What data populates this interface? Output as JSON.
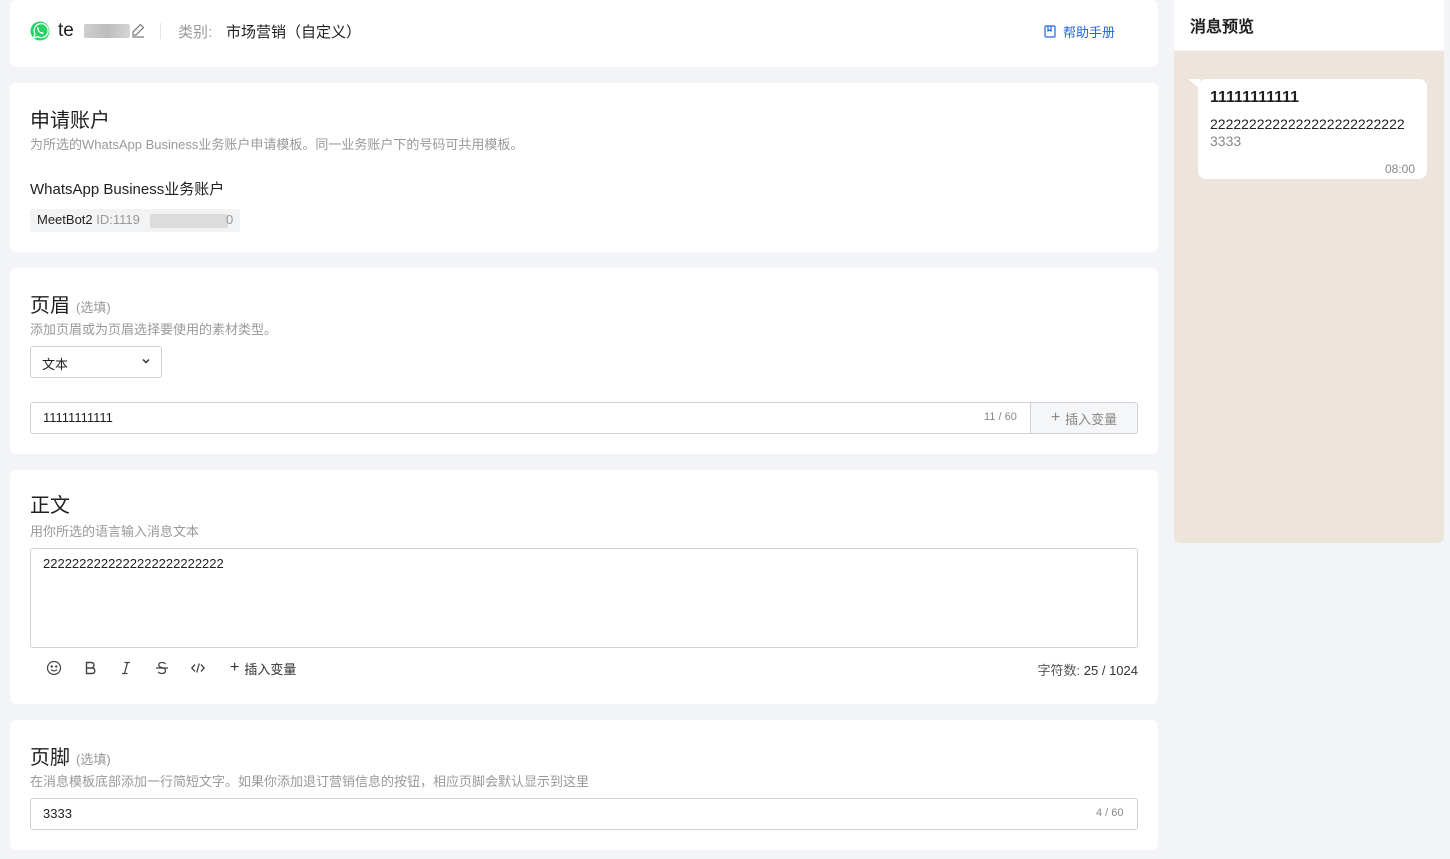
{
  "header": {
    "template_name": "te",
    "category_label": "类别:",
    "category_value": "市场营销（自定义）",
    "help_link": "帮助手册"
  },
  "account": {
    "title": "申请账户",
    "description": "为所选的WhatsApp Business业务账户申请模板。同一业务账户下的号码可共用模板。",
    "field_label": "WhatsApp Business业务账户",
    "account_name": "MeetBot2",
    "account_id_prefix": "ID:1119",
    "account_id_suffix": "0"
  },
  "page_header": {
    "title": "页眉",
    "optional": "(选填)",
    "description": "添加页眉或为页眉选择要使用的素材类型。",
    "type_selected": "文本",
    "text_value": "11111111111",
    "counter": "11 / 60",
    "insert_variable": "插入变量"
  },
  "body": {
    "title": "正文",
    "description": "用你所选的语言输入消息文本",
    "text_value": "2222222222222222222222222",
    "insert_variable": "插入变量",
    "char_count_label": "字符数:",
    "char_count_value": "25 / 1024"
  },
  "footer": {
    "title": "页脚",
    "optional": "(选填)",
    "description": "在消息模板底部添加一行简短文字。如果你添加退订营销信息的按钮，相应页脚会默认显示到这里",
    "text_value": "3333",
    "counter": "4 / 60"
  },
  "preview": {
    "title": "消息预览",
    "header_text": "11111111111",
    "body_text": "2222222222222222222222222",
    "footer_text": "3333",
    "time": "08:00"
  },
  "colors": {
    "accent": "#2366d8",
    "whatsapp_green": "#25d366",
    "preview_bg": "#ede5dc"
  }
}
